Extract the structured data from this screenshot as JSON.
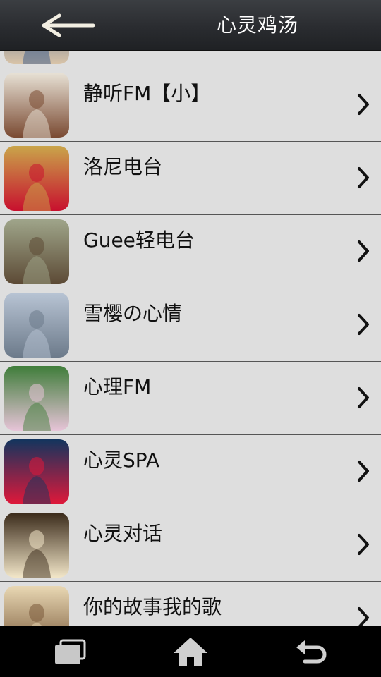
{
  "header": {
    "title": "心灵鸡汤",
    "back_icon": "arrow-left-icon"
  },
  "list": {
    "items": [
      {
        "title": "",
        "thumb_icon": "thumb-partial-photo",
        "thumb_colors": [
          "#3a5a8a",
          "#d9c4a8"
        ]
      },
      {
        "title": "静听FM【小】",
        "thumb_icon": "thumb-girl-sitting-photo",
        "thumb_colors": [
          "#e8e2d6",
          "#7a4a32"
        ]
      },
      {
        "title": "洛尼电台",
        "thumb_icon": "thumb-red-dress-photo",
        "thumb_colors": [
          "#c9a54a",
          "#c8102e"
        ]
      },
      {
        "title": "Guee轻电台",
        "thumb_icon": "thumb-train-window-photo",
        "thumb_colors": [
          "#9fa58a",
          "#5c4a35"
        ]
      },
      {
        "title": "雪樱の心情",
        "thumb_icon": "thumb-seaside-girl-photo",
        "thumb_colors": [
          "#b8c4d4",
          "#6c7a8a"
        ]
      },
      {
        "title": "心理FM",
        "thumb_icon": "thumb-flower-field-photo",
        "thumb_colors": [
          "#3f7d3a",
          "#e7c4d8"
        ]
      },
      {
        "title": "心灵SPA",
        "thumb_icon": "thumb-heart-water-photo",
        "thumb_colors": [
          "#12355e",
          "#e0183a"
        ]
      },
      {
        "title": "心灵对话",
        "thumb_icon": "thumb-bride-window-photo",
        "thumb_colors": [
          "#3a2a1a",
          "#f2e6c8"
        ]
      },
      {
        "title": "你的故事我的歌",
        "thumb_icon": "thumb-girl-light-photo",
        "thumb_colors": [
          "#e9d8b4",
          "#7a5a3a"
        ]
      }
    ],
    "chevron_icon": "chevron-right-icon"
  },
  "navbar": {
    "recent_icon": "recent-apps-icon",
    "home_icon": "home-icon",
    "back_icon": "back-icon"
  }
}
